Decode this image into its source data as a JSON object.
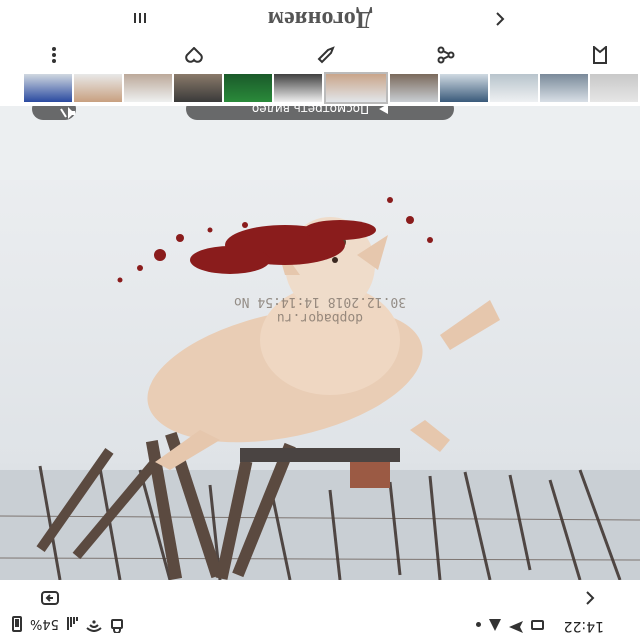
{
  "status_bar": {
    "time": "14:22",
    "battery_text": "54%",
    "icons": [
      "image-icon",
      "send-icon",
      "triangle-icon",
      "dot-icon",
      "vpn-icon",
      "wifi-icon",
      "signal-icon",
      "battery-icon"
    ]
  },
  "nav": {
    "back_icon": "back-icon",
    "rotate_icon": "rotate-icon"
  },
  "photo": {
    "watermark_url": "dopbaqor.ru",
    "watermark_date": "30.12.2018 14:14:54 No",
    "view_original_label": "Посмотреть видео",
    "mute_icon": "mute-icon"
  },
  "thumbnails": {
    "count": 12,
    "selected_index": 5
  },
  "actions": {
    "items": [
      "bookmark-icon",
      "share-icon",
      "edit-icon",
      "favorite-icon",
      "more-icon"
    ]
  },
  "header": {
    "title": "Догоняем",
    "back_icon": "back-icon",
    "menu_icon": "menu-icon"
  },
  "colors": {
    "pill_bg": "#3c3c3c",
    "dog_fur": "#e9cdb5",
    "blood": "#8a1c1c"
  }
}
